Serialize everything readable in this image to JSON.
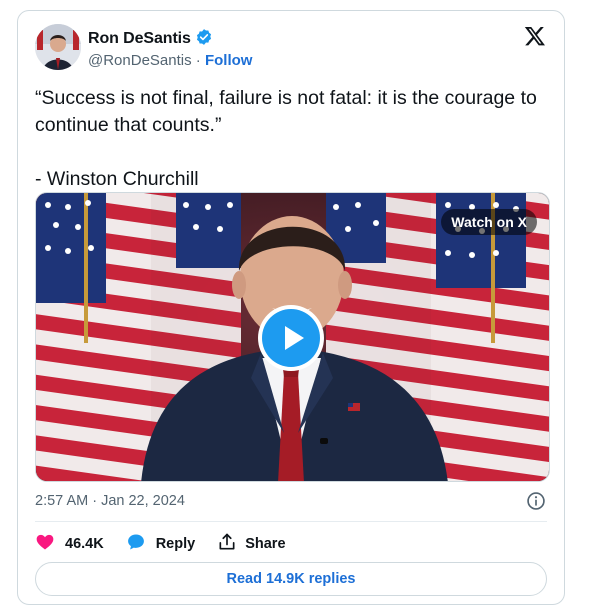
{
  "author": {
    "name": "Ron DeSantis",
    "handle": "@RonDeSantis",
    "separator": "·",
    "follow_label": "Follow",
    "avatar_icon": "avatar-portrait",
    "verified_icon": "verified-badge-icon",
    "verified_color": "#1d9bf0"
  },
  "brand_icon": "x-logo-icon",
  "tweet": {
    "text": "“Success is not final, failure is not fatal: it is the courage to continue that counts.”\n\n- Winston Churchill"
  },
  "media": {
    "watch_label": "Watch on X",
    "play_icon": "play-icon",
    "play_color": "#1d9bf0"
  },
  "meta": {
    "timestamp": "2:57 AM · Jan 22, 2024",
    "info_icon": "info-icon"
  },
  "actions": {
    "likes": "46.4K",
    "like_icon": "heart-icon",
    "like_color": "#f91880",
    "reply_label": "Reply",
    "reply_icon": "speech-bubble-icon",
    "share_label": "Share",
    "share_icon": "share-upload-icon"
  },
  "replies_button": "Read 14.9K replies",
  "colors": {
    "link": "#1d6fd6",
    "text": "#0f1419",
    "muted": "#536471",
    "border": "#cfd9de"
  }
}
